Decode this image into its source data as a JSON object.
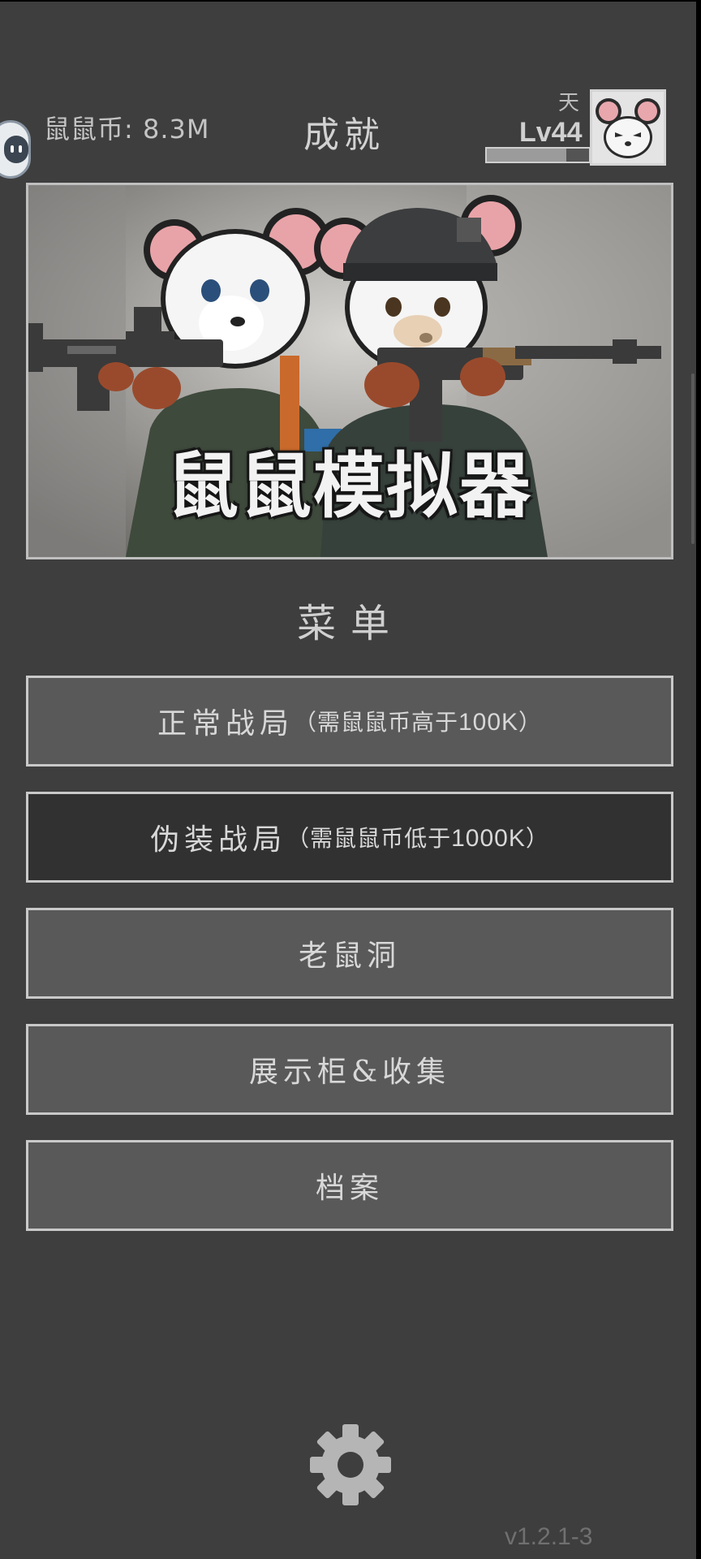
{
  "header": {
    "coins_label": "鼠鼠币: 8.3M",
    "achievements_label": "成就",
    "rank_label": "天",
    "level_label": "Lv44",
    "xp_progress": 0.78
  },
  "banner": {
    "title": "鼠鼠模拟器"
  },
  "menu": {
    "title": "菜单",
    "items": [
      {
        "main": "正常战局",
        "sub_open": "（需鼠鼠币高于",
        "sub_num": "100K",
        "sub_close": "）"
      },
      {
        "main": "伪装战局",
        "sub_open": "（需鼠鼠币低于",
        "sub_num": "1000K",
        "sub_close": "）"
      },
      {
        "main": "老鼠洞"
      },
      {
        "main": "展示柜&收集"
      },
      {
        "main": "档案"
      }
    ]
  },
  "footer": {
    "version": "v1.2.1-3"
  },
  "icons": {
    "settings": "gear-icon",
    "assistant": "floating-assistant-icon"
  },
  "colors": {
    "background": "#3e3e3e",
    "button": "#595959",
    "button_selected": "#313131",
    "border": "#c9c9c9"
  }
}
